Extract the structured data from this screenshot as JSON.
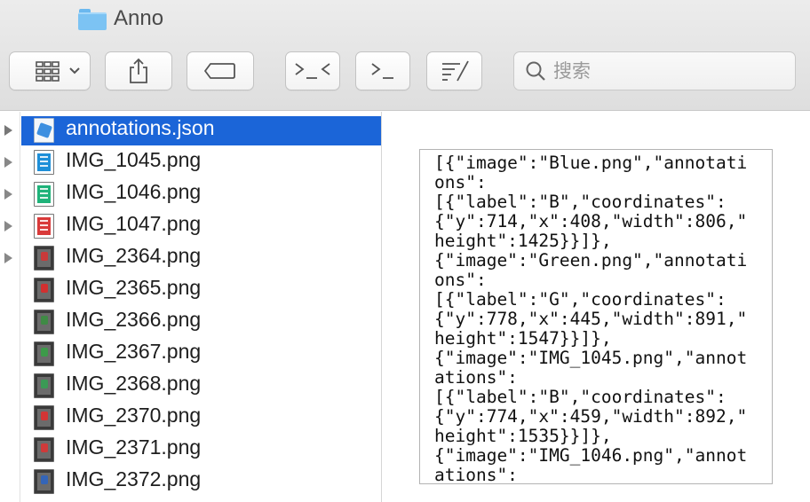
{
  "window": {
    "title": "Anno"
  },
  "toolbar": {
    "search_placeholder": "搜索",
    "buttons": [
      {
        "name": "view-mode-button",
        "icon": "grid-view-icon"
      },
      {
        "name": "share-button",
        "icon": "share-icon"
      },
      {
        "name": "tags-button",
        "icon": "tag-icon"
      },
      {
        "name": "run-script-button",
        "icon": "terminal-script-icon"
      },
      {
        "name": "open-terminal-button",
        "icon": "terminal-icon"
      },
      {
        "name": "edit-button",
        "icon": "edit-list-icon"
      }
    ]
  },
  "files": [
    {
      "name": "annotations.json",
      "icon": "json-file-icon",
      "selected": true,
      "expandable": true
    },
    {
      "name": "IMG_1045.png",
      "icon": "image-thumbnail-icon",
      "thumb_color": "#1e8fd8",
      "expandable": true
    },
    {
      "name": "IMG_1046.png",
      "icon": "image-thumbnail-icon",
      "thumb_color": "#1fb37a",
      "expandable": true
    },
    {
      "name": "IMG_1047.png",
      "icon": "image-thumbnail-icon",
      "thumb_color": "#d93a3a",
      "expandable": true
    },
    {
      "name": "IMG_2364.png",
      "icon": "image-thumbnail-icon",
      "thumb_color": "#c83a3a",
      "expandable": true
    },
    {
      "name": "IMG_2365.png",
      "icon": "image-thumbnail-icon",
      "thumb_color": "#d23030",
      "expandable": false
    },
    {
      "name": "IMG_2366.png",
      "icon": "image-thumbnail-icon",
      "thumb_color": "#3f8a45",
      "expandable": false
    },
    {
      "name": "IMG_2367.png",
      "icon": "image-thumbnail-icon",
      "thumb_color": "#3d9a4a",
      "expandable": false
    },
    {
      "name": "IMG_2368.png",
      "icon": "image-thumbnail-icon",
      "thumb_color": "#3b9a55",
      "expandable": false
    },
    {
      "name": "IMG_2370.png",
      "icon": "image-thumbnail-icon",
      "thumb_color": "#d23535",
      "expandable": false
    },
    {
      "name": "IMG_2371.png",
      "icon": "image-thumbnail-icon",
      "thumb_color": "#cf3a3a",
      "expandable": false
    },
    {
      "name": "IMG_2372.png",
      "icon": "image-thumbnail-icon",
      "thumb_color": "#3465b8",
      "expandable": false
    }
  ],
  "preview": {
    "lines": [
      "[{\"image\":\"Blue.png\",\"annotati",
      "ons\":",
      "[{\"label\":\"B\",\"coordinates\":",
      "{\"y\":714,\"x\":408,\"width\":806,\"",
      "height\":1425}}]},",
      "{\"image\":\"Green.png\",\"annotati",
      "ons\":",
      "[{\"label\":\"G\",\"coordinates\":",
      "{\"y\":778,\"x\":445,\"width\":891,\"",
      "height\":1547}}]},",
      "{\"image\":\"IMG_1045.png\",\"annot",
      "ations\":",
      "[{\"label\":\"B\",\"coordinates\":",
      "{\"y\":774,\"x\":459,\"width\":892,\"",
      "height\":1535}}]},",
      "{\"image\":\"IMG_1046.png\",\"annot",
      "ations\":"
    ]
  },
  "colors": {
    "selection": "#1b65d8",
    "folder": "#7cc3f3"
  }
}
